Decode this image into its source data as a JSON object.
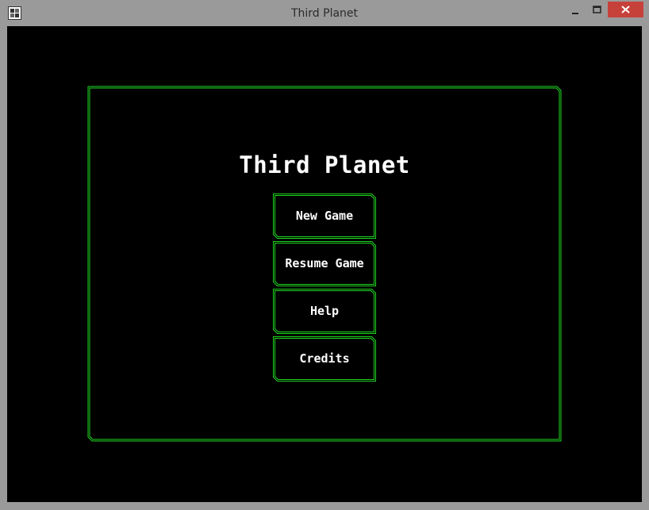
{
  "window": {
    "title": "Third Planet",
    "app_icon": "app-window-icon",
    "controls": {
      "minimize": "minimize-icon",
      "maximize": "maximize-icon",
      "close": "close-icon"
    }
  },
  "game": {
    "title": "Third Planet",
    "accent_color": "#1fd41f",
    "background_color": "#000000",
    "menu": [
      {
        "id": "new-game",
        "label": "New Game"
      },
      {
        "id": "resume-game",
        "label": "Resume Game"
      },
      {
        "id": "help",
        "label": "Help"
      },
      {
        "id": "credits",
        "label": "Credits"
      }
    ]
  }
}
